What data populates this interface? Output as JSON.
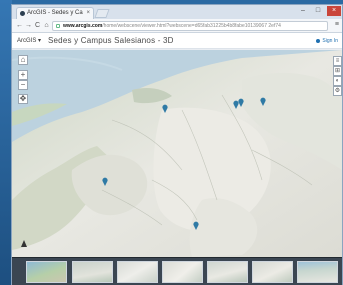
{
  "browser": {
    "tab_title": "ArcGIS - Sedes y Ca",
    "tab_close": "×",
    "window_controls": {
      "minimize": "–",
      "maximize": "□",
      "close": "×"
    },
    "nav": {
      "back": "←",
      "forward": "→",
      "reload": "C",
      "home": "⌂"
    },
    "address_host": "www.arcgis.com",
    "address_path": "/home/webscene/viewer.html?webscene=d65fab31225b4b8fabe10139067 2ef74",
    "menu": "≡"
  },
  "app": {
    "brand": "ArcGIS ▾",
    "title": "Sedes y Campus Salesianos - 3D",
    "signin": "Sign In"
  },
  "map_controls": {
    "home": "⌂",
    "zoom_in": "+",
    "zoom_out": "−",
    "navigate": "✥",
    "right_tools": [
      "≡",
      "⊞",
      "◐",
      "⚙"
    ]
  },
  "slides": [
    {
      "id": "slide-1"
    },
    {
      "id": "slide-2"
    },
    {
      "id": "slide-3"
    },
    {
      "id": "slide-4"
    },
    {
      "id": "slide-5"
    },
    {
      "id": "slide-6"
    },
    {
      "id": "slide-7"
    }
  ],
  "colors": {
    "sea": "#bdd3e0",
    "land": "#e4e6df",
    "pin": "#2f7aa5",
    "desktop": "#2b6aa3"
  }
}
